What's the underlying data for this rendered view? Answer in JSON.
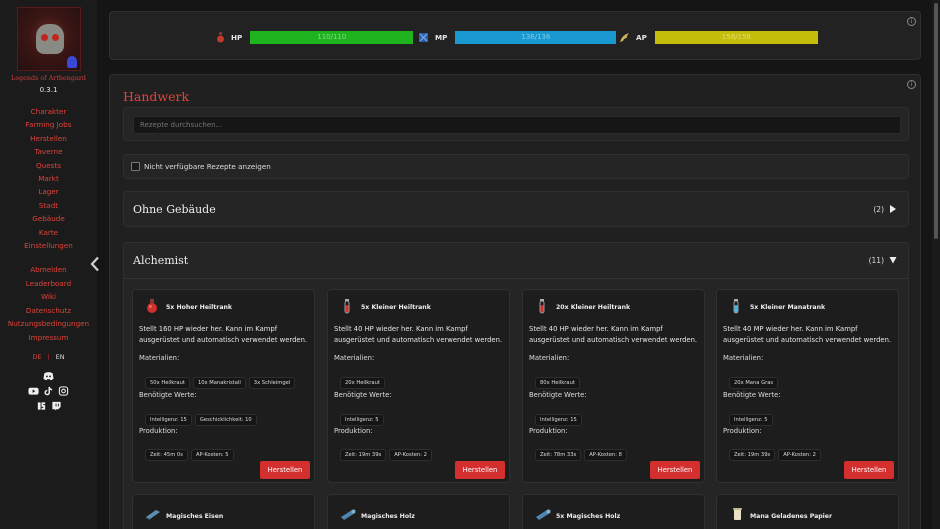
{
  "app": {
    "name": "Legends of Arthengard",
    "version": "0.3.1"
  },
  "sidebar": {
    "nav": [
      "Charakter",
      "Farming Jobs",
      "Herstellen",
      "Taverne",
      "Quests",
      "Markt",
      "Lager",
      "Stadt",
      "Gebäude",
      "Karte",
      "Einstellungen"
    ],
    "nav2": [
      "Abmelden",
      "Leaderboard",
      "Wiki",
      "Datenschutz",
      "Nutzungsbedingungen",
      "Impressum"
    ],
    "lang": {
      "de": "DE",
      "sep": "|",
      "en": "EN"
    },
    "socials": [
      "discord-icon",
      "youtube-icon",
      "tiktok-icon",
      "instagram-icon",
      "itchio-icon",
      "twitch-icon"
    ]
  },
  "stats": {
    "hp": {
      "label": "HP",
      "value": "110/110",
      "pct": 1.0,
      "color": "#1fb31f"
    },
    "mp": {
      "label": "MP",
      "value": "136/136",
      "pct": 1.0,
      "color": "#1a98d0"
    },
    "ap": {
      "label": "AP",
      "value": "158/158",
      "pct": 1.0,
      "color": "#c4be0a"
    }
  },
  "crafting": {
    "title": "Handwerk",
    "search_placeholder": "Rezepte durchsuchen...",
    "show_unavailable": "Nicht verfügbare Rezepte anzeigen",
    "sections": [
      {
        "title": "Ohne Gebäude",
        "count": "(2)"
      },
      {
        "title": "Alchemist",
        "count": "(11)"
      }
    ],
    "labels": {
      "materials": "Materialien:",
      "required": "Benötigte Werte:",
      "production": "Produktion:",
      "craft": "Herstellen"
    },
    "cards": [
      {
        "name": "5x Hoher Heiltrank",
        "icon": "red-potion-icon",
        "desc": "Stellt 160 HP wieder her. Kann im Kampf ausgerüstet und automatisch verwendet werden.",
        "materials": [
          "50x Heilkraut",
          "10x Manakristall",
          "3x Schleimgel"
        ],
        "required": [
          "Intelligenz: 15",
          "Geschicklichkeit: 10"
        ],
        "production": [
          "Zeit: 45m 0s",
          "AP-Kosten: 5"
        ]
      },
      {
        "name": "5x Kleiner Heiltrank",
        "icon": "red-vial-icon",
        "desc": "Stellt 40 HP wieder her. Kann im Kampf ausgerüstet und automatisch verwendet werden.",
        "materials": [
          "20x Heilkraut"
        ],
        "required": [
          "Intelligenz: 5"
        ],
        "production": [
          "Zeit: 19m 39s",
          "AP-Kosten: 2"
        ]
      },
      {
        "name": "20x Kleiner Heiltrank",
        "icon": "red-vial-icon",
        "desc": "Stellt 40 HP wieder her. Kann im Kampf ausgerüstet und automatisch verwendet werden.",
        "materials": [
          "80x Heilkraut"
        ],
        "required": [
          "Intelligenz: 15"
        ],
        "production": [
          "Zeit: 78m 33s",
          "AP-Kosten: 8"
        ]
      },
      {
        "name": "5x Kleiner Manatrank",
        "icon": "blue-vial-icon",
        "desc": "Stellt 40 MP wieder her. Kann im Kampf ausgerüstet und automatisch verwendet werden.",
        "materials": [
          "20x Mana Gras"
        ],
        "required": [
          "Intelligenz: 5"
        ],
        "production": [
          "Zeit: 19m 39s",
          "AP-Kosten: 2"
        ]
      }
    ],
    "cards_row2": [
      {
        "name": "Magisches Eisen",
        "icon": "ingot-icon"
      },
      {
        "name": "Magisches Holz",
        "icon": "log-icon"
      },
      {
        "name": "5x Magisches Holz",
        "icon": "log-icon"
      },
      {
        "name": "Mana Geladenes Papier",
        "icon": "scroll-icon"
      }
    ]
  }
}
